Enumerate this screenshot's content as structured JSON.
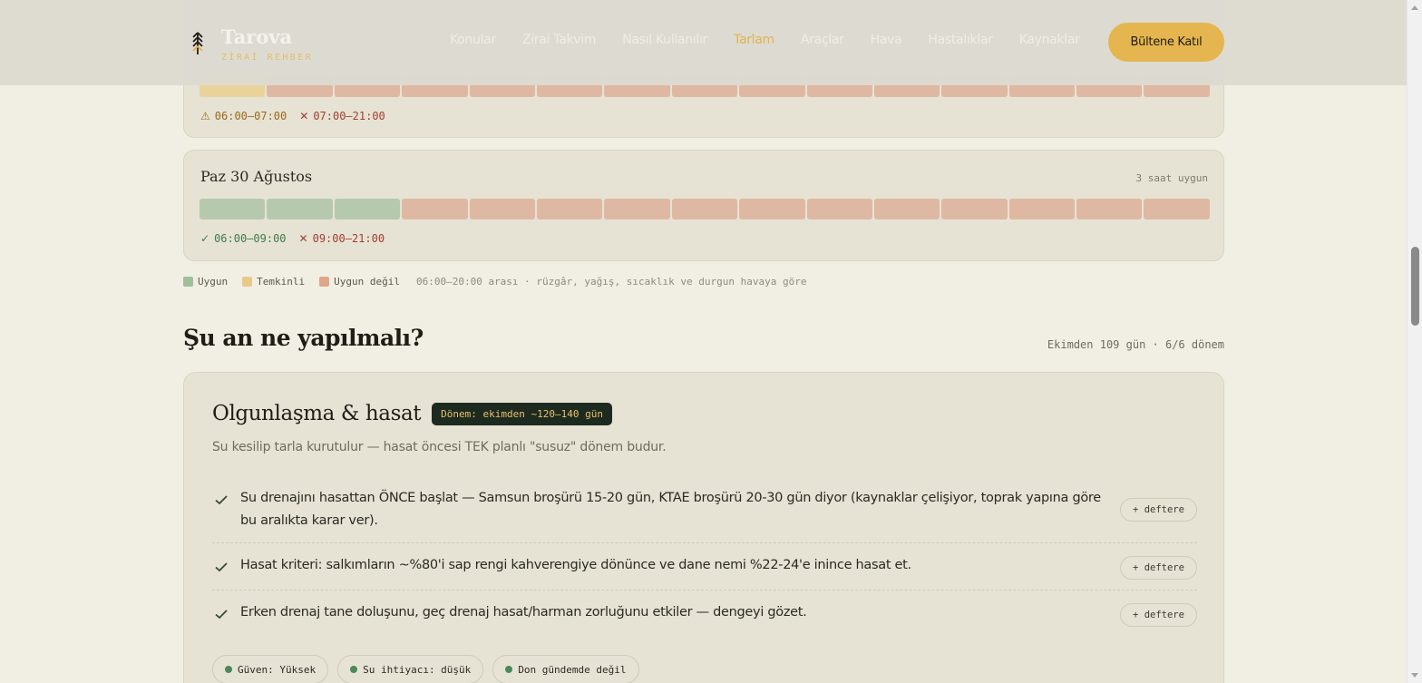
{
  "header": {
    "brand": "Tarova",
    "tagline": "ZİRAİ REHBER",
    "nav": [
      "Konular",
      "Zirai Takvim",
      "Nasıl Kullanılır",
      "Tarlam",
      "Araçlar",
      "Hava",
      "Hastalıklar",
      "Kaynaklar"
    ],
    "active_nav": "Tarlam",
    "cta": "Bültene Katıl"
  },
  "days": [
    {
      "title": "",
      "hours_text": "",
      "slots": [
        "warn",
        "bad",
        "bad",
        "bad",
        "bad",
        "bad",
        "bad",
        "bad",
        "bad",
        "bad",
        "bad",
        "bad",
        "bad",
        "bad",
        "bad"
      ],
      "ranges": [
        {
          "status": "warn",
          "icon": "warning-icon",
          "text": "06:00–07:00"
        },
        {
          "status": "bad",
          "icon": "cross-icon",
          "text": "07:00–21:00"
        }
      ]
    },
    {
      "title": "Paz 30 Ağustos",
      "hours_text": "3 saat uygun",
      "slots": [
        "ok",
        "ok",
        "ok",
        "bad",
        "bad",
        "bad",
        "bad",
        "bad",
        "bad",
        "bad",
        "bad",
        "bad",
        "bad",
        "bad",
        "bad"
      ],
      "ranges": [
        {
          "status": "ok",
          "icon": "check-icon",
          "text": "06:00–09:00"
        },
        {
          "status": "bad",
          "icon": "cross-icon",
          "text": "09:00–21:00"
        }
      ]
    }
  ],
  "legend": {
    "ok": "Uygun",
    "warn": "Temkinli",
    "bad": "Uygun değil",
    "note": "06:00–20:00 arası · rüzgâr, yağış, sıcaklık ve durgun havaya göre"
  },
  "section": {
    "title": "Şu an ne yapılmalı?",
    "meta": "Ekimden 109 gün · 6/6 dönem"
  },
  "stage": {
    "title": "Olgunlaşma & hasat",
    "badge": "Dönem: ekimden ~120–140 gün",
    "desc": "Su kesilip tarla kurutulur — hasat öncesi TEK planlı \"susuz\" dönem budur.",
    "note_button": "+ deftere",
    "tasks": [
      "Su drenajını hasattan ÖNCE başlat — Samsun broşürü 15-20 gün, KTAE broşürü 20-30 gün diyor (kaynaklar çelişiyor, toprak yapına göre bu aralıkta karar ver).",
      "Hasat kriteri: salkımların ~%80'i sap rengi kahverengiye dönünce ve dane nemi %22-24'e inince hasat et.",
      "Erken drenaj tane doluşunu, geç drenaj hasat/harman zorluğunu etkiler — dengeyi gözet."
    ],
    "chips": [
      "Güven: Yüksek",
      "Su ihtiyacı: düşük",
      "Don gündemde değil"
    ]
  },
  "colors": {
    "ok": "#b6c9ae",
    "warn": "#ead39b",
    "bad": "#dfb8a3",
    "accent": "#e5b54f"
  }
}
